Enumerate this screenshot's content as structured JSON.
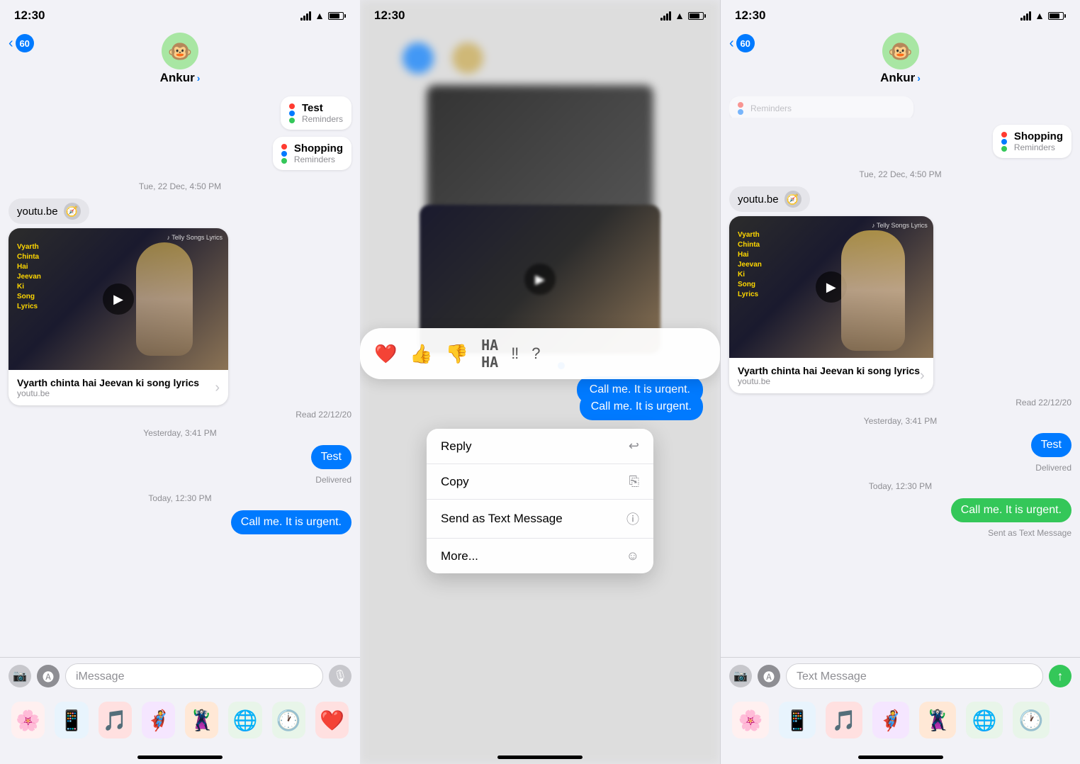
{
  "left_panel": {
    "status_bar": {
      "time": "12:30",
      "location_arrow": "▲",
      "wifi": "WiFi",
      "battery": "Battery"
    },
    "nav": {
      "back_count": "60",
      "contact_name": "Ankur",
      "contact_chevron": "›",
      "avatar_emoji": "🐵"
    },
    "reminders": [
      {
        "title": "Test",
        "subtitle": "Reminders"
      },
      {
        "title": "Shopping",
        "subtitle": "Reminders"
      }
    ],
    "timestamp1": "Tue, 22 Dec, 4:50 PM",
    "yt_link": "youtu.be",
    "video": {
      "overlay_text": "Vyarth\nChinta\nHai\nJeevan\nKi\nSong\nLyrics",
      "title": "Vyarth chinta hai Jeevan ki song lyrics",
      "url": "youtu.be"
    },
    "read_label": "Read 22/12/20",
    "timestamp2": "Yesterday, 3:41 PM",
    "msg_test": "Test",
    "msg_test_status": "Delivered",
    "timestamp3": "Today, 12:30 PM",
    "msg_urgent": "Call me. It is urgent.",
    "input_placeholder": "iMessage",
    "dock_apps": [
      "🌸",
      "📱",
      "🎵",
      "🦸",
      "🦹",
      "🌐",
      "🕐",
      "❤️"
    ]
  },
  "middle_panel": {
    "status_bar": {
      "time": "12:30"
    },
    "reactions": [
      "❤️",
      "👍",
      "👎",
      "😂",
      "‼️",
      "❓"
    ],
    "bubble_text": "Call me. It is urgent.",
    "context_menu": [
      {
        "label": "Reply",
        "icon": "↩"
      },
      {
        "label": "Copy",
        "icon": "📋"
      },
      {
        "label": "Send as Text Message",
        "icon": "ℹ"
      },
      {
        "label": "More...",
        "icon": "☺"
      }
    ]
  },
  "right_panel": {
    "status_bar": {
      "time": "12:30"
    },
    "nav": {
      "back_count": "60",
      "contact_name": "Ankur",
      "contact_chevron": "›",
      "avatar_emoji": "🐵"
    },
    "reminders_label": "Shopping",
    "reminders_sub": "Reminders",
    "timestamp1": "Tue, 22 Dec, 4:50 PM",
    "yt_link": "youtu.be",
    "video": {
      "overlay_text": "Vyarth\nChinta\nHai\nJeevan\nKi\nSong\nLyrics",
      "title": "Vyarth chinta hai Jeevan ki song lyrics",
      "url": "youtu.be"
    },
    "read_label": "Read 22/12/20",
    "timestamp2": "Yesterday, 3:41 PM",
    "msg_test": "Test",
    "msg_test_status": "Delivered",
    "timestamp3": "Today, 12:30 PM",
    "msg_urgent": "Call me. It is urgent.",
    "sent_as_label": "Sent as Text Message",
    "input_placeholder": "Text Message",
    "dock_apps": [
      "🌸",
      "📱",
      "🎵",
      "🦸",
      "🦹",
      "🌐",
      "🕐"
    ]
  }
}
